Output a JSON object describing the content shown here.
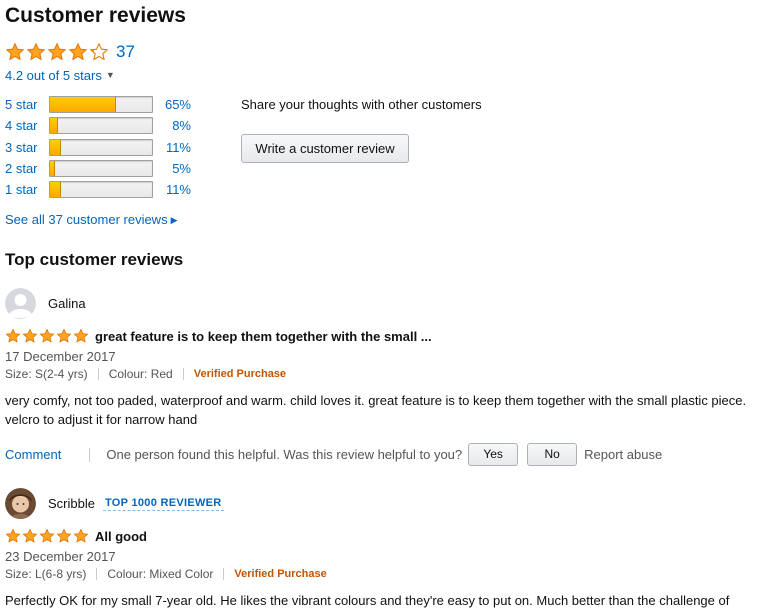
{
  "header": {
    "title": "Customer reviews"
  },
  "summary": {
    "rating": 4.2,
    "review_count": "37",
    "average_text": "4.2 out of 5 stars",
    "colors": {
      "star": "#ffa41c",
      "star_outline": "#e47911",
      "link": "#0066c0",
      "verified": "#c45500"
    }
  },
  "histogram": [
    {
      "label": "5 star",
      "percent": "65%",
      "fraction": 0.65
    },
    {
      "label": "4 star",
      "percent": "8%",
      "fraction": 0.08
    },
    {
      "label": "3 star",
      "percent": "11%",
      "fraction": 0.11
    },
    {
      "label": "2 star",
      "percent": "5%",
      "fraction": 0.05
    },
    {
      "label": "1 star",
      "percent": "11%",
      "fraction": 0.11
    }
  ],
  "share": {
    "text": "Share your thoughts with other customers",
    "button_label": "Write a customer review"
  },
  "see_all": {
    "label": "See all 37 customer reviews"
  },
  "top_reviews": {
    "heading": "Top customer reviews",
    "reviews": [
      {
        "reviewer": "Galina",
        "avatar": "default-avatar-icon",
        "rating": 5,
        "title": "great feature is to keep them together with the small ...",
        "date": "17 December 2017",
        "size": "Size: S(2-4 yrs)",
        "colour": "Colour: Red",
        "verified": "Verified Purchase",
        "body": "very comfy, not too paded, waterproof and warm. child loves it. great feature is to keep them together with the small plastic piece. velcro to adjust it for narrow hand",
        "comment_label": "Comment",
        "helpful_text": "One person found this helpful. Was this review helpful to you?",
        "yes_label": "Yes",
        "no_label": "No",
        "report_label": "Report abuse"
      },
      {
        "reviewer": "Scribble",
        "avatar": "user-photo-avatar",
        "badge": "TOP 1000 REVIEWER",
        "rating": 5,
        "title": "All good",
        "date": "23 December 2017",
        "size": "Size: L(6-8 yrs)",
        "colour": "Colour: Mixed Color",
        "verified": "Verified Purchase",
        "body": "Perfectly OK for my small 7-year old. He likes the vibrant colours and they're easy to put on. Much better than the challenge of"
      }
    ]
  }
}
